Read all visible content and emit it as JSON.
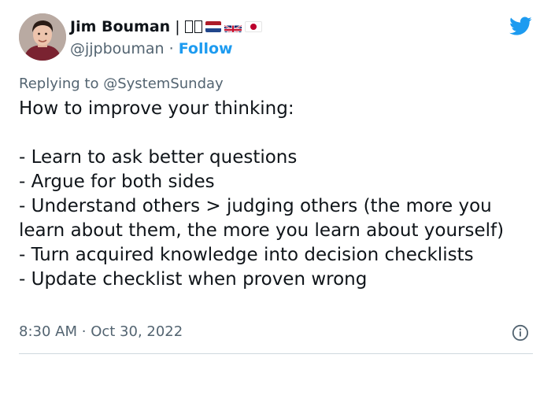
{
  "author": {
    "display_name": "Jim Bouman",
    "name_separator": "|",
    "handle": "@jjpbouman",
    "handle_separator": "·",
    "follow_label": "Follow",
    "avatar_icon": "avatar-photo",
    "flags": [
      "netherlands-flag-icon",
      "uk-flag-icon",
      "japan-flag-icon"
    ]
  },
  "platform_icon": "twitter-bird-icon",
  "reply": {
    "prefix": "Replying to",
    "target": "@SystemSunday"
  },
  "tweet": {
    "lines": [
      "How to improve your thinking:",
      "",
      "- Learn to ask better questions",
      "- Argue for both sides",
      "- Understand others > judging others (the more you learn about them, the more you learn about yourself)",
      "- Turn acquired knowledge into decision checklists",
      "- Update checklist when proven wrong"
    ]
  },
  "meta": {
    "time": "8:30 AM",
    "separator": "·",
    "date": "Oct 30, 2022",
    "info_icon": "info-icon"
  },
  "colors": {
    "accent": "#1d9bf0",
    "secondary_text": "#536471",
    "primary_text": "#0f1419",
    "divider": "#cfd9de"
  }
}
